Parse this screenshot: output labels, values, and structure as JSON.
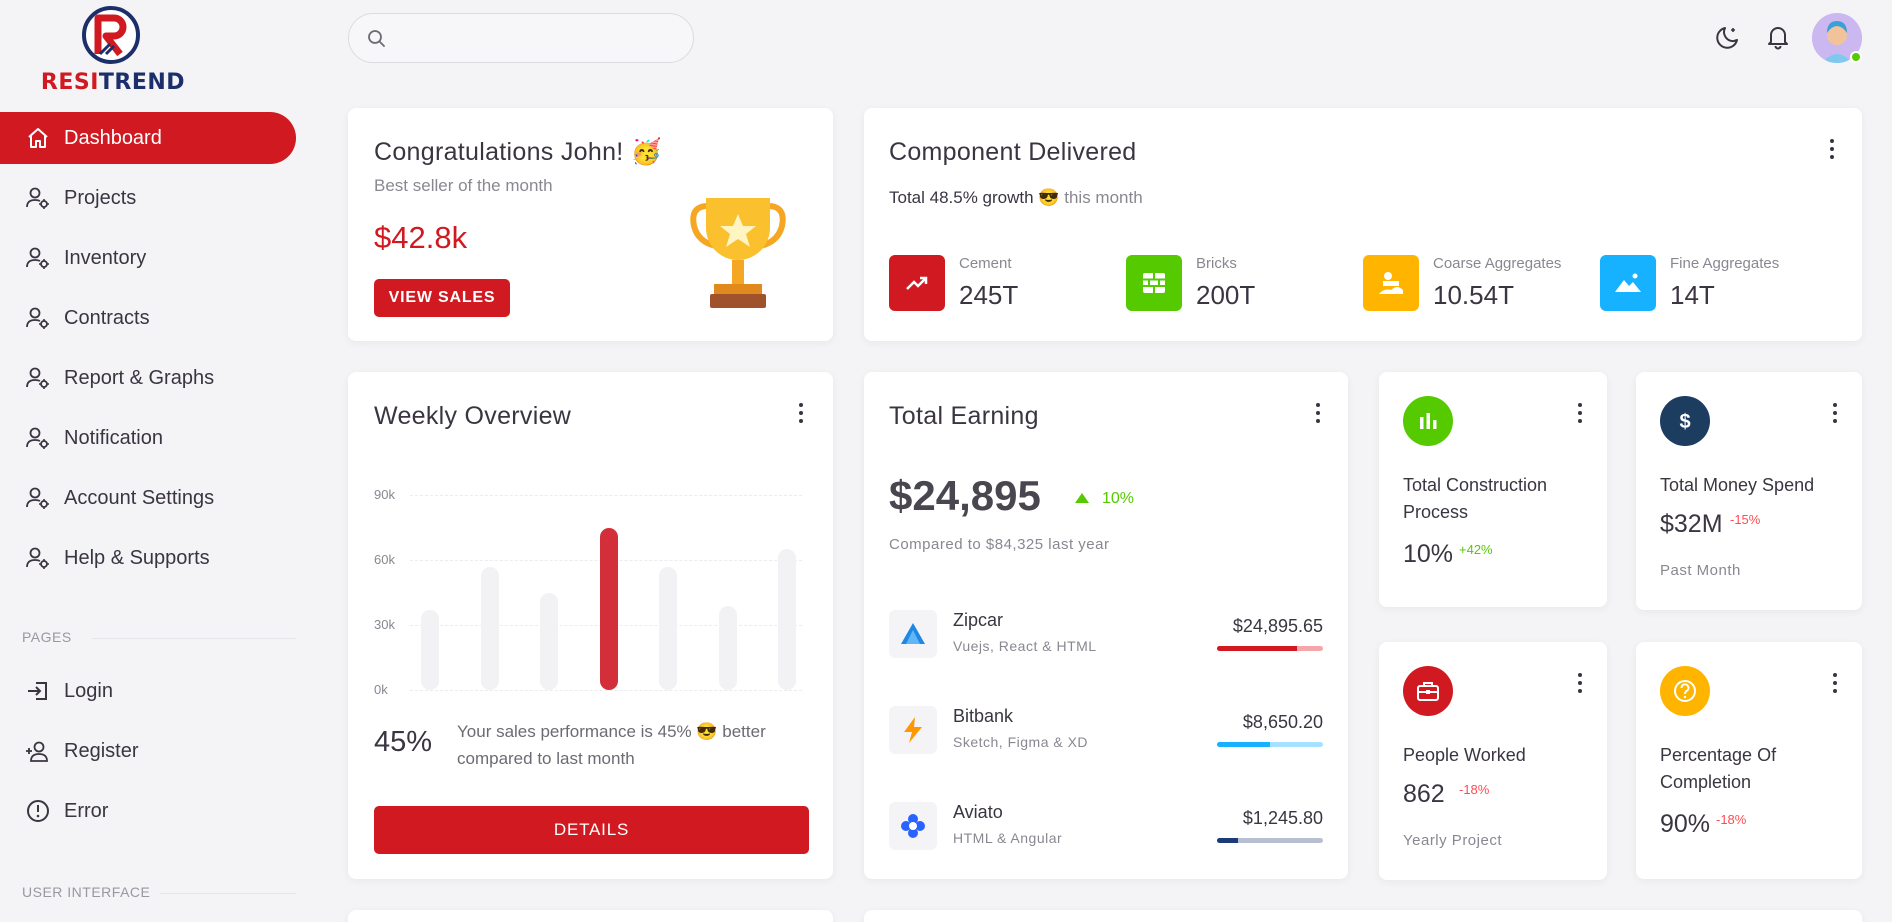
{
  "brand": {
    "name": "RESITREND"
  },
  "sidebar": {
    "items": [
      {
        "label": "Dashboard",
        "icon": "home-icon",
        "active": true
      },
      {
        "label": "Projects",
        "icon": "user-gear-icon"
      },
      {
        "label": "Inventory",
        "icon": "user-gear-icon"
      },
      {
        "label": "Contracts",
        "icon": "user-gear-icon"
      },
      {
        "label": "Report & Graphs",
        "icon": "user-gear-icon"
      },
      {
        "label": "Notification",
        "icon": "user-gear-icon"
      },
      {
        "label": "Account Settings",
        "icon": "user-gear-icon"
      },
      {
        "label": "Help & Supports",
        "icon": "user-gear-icon"
      }
    ],
    "pages_section": "PAGES",
    "pages": [
      {
        "label": "Login",
        "icon": "login-icon"
      },
      {
        "label": "Register",
        "icon": "user-plus-icon"
      },
      {
        "label": "Error",
        "icon": "alert-circle-icon"
      }
    ],
    "ui_section": "USER INTERFACE"
  },
  "header": {
    "search_placeholder": "",
    "icons": [
      "moon-star-icon",
      "bell-icon",
      "avatar"
    ]
  },
  "congrats": {
    "title": "Congratulations John! 🥳",
    "subtitle": "Best seller of the month",
    "amount": "$42.8k",
    "button": "VIEW SALES"
  },
  "component": {
    "title": "Component Delivered",
    "growth": "Total 48.5% growth",
    "emoji": "😎",
    "period": "this month",
    "stats": [
      {
        "label": "Cement",
        "value": "245T",
        "color": "#d01920",
        "icon": "trending-up-icon"
      },
      {
        "label": "Bricks",
        "value": "200T",
        "color": "#56ca00",
        "icon": "bricks-icon"
      },
      {
        "label": "Coarse Aggregates",
        "value": "10.54T",
        "color": "#ffb400",
        "icon": "aggregate-icon"
      },
      {
        "label": "Fine Aggregates",
        "value": "14T",
        "color": "#16b1ff",
        "icon": "mountain-icon"
      }
    ]
  },
  "weekly": {
    "title": "Weekly Overview",
    "percent": "45%",
    "text": "Your sales performance is 45% 😎 better compared to last month",
    "button": "DETAILS"
  },
  "chart_data": {
    "type": "bar",
    "categories": [
      "",
      "",
      "",
      "",
      "",
      "",
      "",
      ""
    ],
    "values": [
      37,
      57,
      45,
      75,
      57,
      39,
      65,
      0
    ],
    "highlight_index": 3,
    "highlight_color": "#d32f3a",
    "ylim": [
      0,
      90
    ],
    "yticks": [
      "90k",
      "60k",
      "30k",
      "0k"
    ],
    "grid": true
  },
  "earning": {
    "title": "Total Earning",
    "amount": "$24,895",
    "change": "10%",
    "compare": "Compared to $84,325 last year",
    "items": [
      {
        "name": "Zipcar",
        "sub": "Vuejs, React & HTML",
        "amount": "$24,895.65",
        "icon": "zipcar-logo-icon",
        "progress": 0.75,
        "color": "#d01920",
        "track": "#f5a6ab"
      },
      {
        "name": "Bitbank",
        "sub": "Sketch, Figma & XD",
        "amount": "$8,650.20",
        "icon": "bolt-icon",
        "progress": 0.5,
        "color": "#16b1ff",
        "track": "#a6e2ff"
      },
      {
        "name": "Aviato",
        "sub": "HTML & Angular",
        "amount": "$1,245.80",
        "icon": "flower-icon",
        "progress": 0.2,
        "color": "#1c3c78",
        "track": "#b8bfd0"
      }
    ]
  },
  "kpis": [
    {
      "label1": "Total Construction",
      "label2": "Process",
      "value": "10%",
      "change": "+42%",
      "change_color": "#56ca00",
      "footer": "",
      "color": "#56ca00",
      "icon": "chart-bar-icon"
    },
    {
      "label1": "Total Money Spend",
      "label2": "",
      "value": "$32M",
      "change": "-15%",
      "change_color": "#ff4c51",
      "footer": "Past Month",
      "color": "#1c3c60",
      "icon": "dollar-icon"
    },
    {
      "label1": "People Worked",
      "label2": "",
      "value": "862",
      "change": "-18%",
      "change_color": "#ff4c51",
      "footer": "Yearly Project",
      "color": "#d01920",
      "icon": "briefcase-icon"
    },
    {
      "label1": "Percentage Of",
      "label2": "Completion",
      "value": "90%",
      "change": "-18%",
      "change_color": "#ff4c51",
      "footer": "",
      "color": "#ffb400",
      "icon": "help-circle-icon"
    }
  ]
}
